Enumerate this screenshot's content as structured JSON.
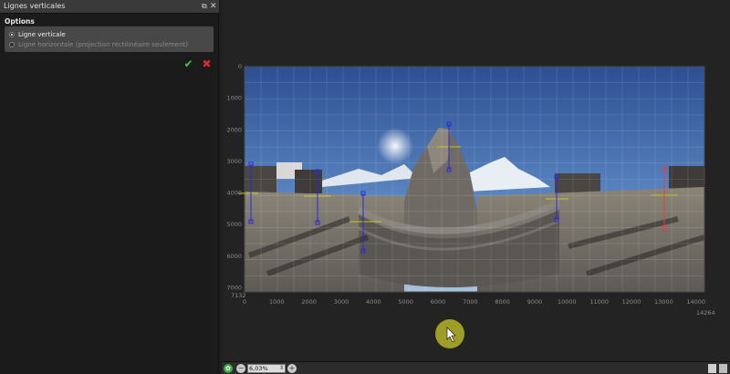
{
  "panel": {
    "title": "Lignes verticales",
    "float_glyph": "⧉",
    "close_glyph": "✕",
    "options_label": "Options",
    "options": [
      {
        "label": "Ligne verticale",
        "selected": true
      },
      {
        "label": "Ligne horizontale (projection rectilinéaire seulement)",
        "selected": false
      }
    ],
    "confirm_glyph": "✔",
    "cancel_glyph": "✖",
    "icons": {
      "confirm": "checkmark-icon",
      "cancel": "cross-icon"
    }
  },
  "viewer": {
    "y_ticks": [
      "0",
      "1000",
      "2000",
      "3000",
      "4000",
      "5000",
      "6000",
      "7000"
    ],
    "y_max_label": "7132",
    "x_ticks": [
      "0",
      "1000",
      "2000",
      "3000",
      "4000",
      "5000",
      "6000",
      "7000",
      "8000",
      "9000",
      "10000",
      "11000",
      "12000",
      "13000",
      "14000"
    ],
    "x_max_label": "14264",
    "image_description_icon": "panorama-image",
    "handle_color_blue": "#2a2ad8",
    "handle_color_red": "#e04050",
    "guide_color": "#c8c820",
    "cursor_highlight_color": "#b4b428"
  },
  "bottombar": {
    "fit_glyph": "✿",
    "zoom_out_glyph": "−",
    "zoom_value": "6,03%",
    "zoom_spin_glyph": "⇕",
    "zoom_in_glyph": "+"
  }
}
